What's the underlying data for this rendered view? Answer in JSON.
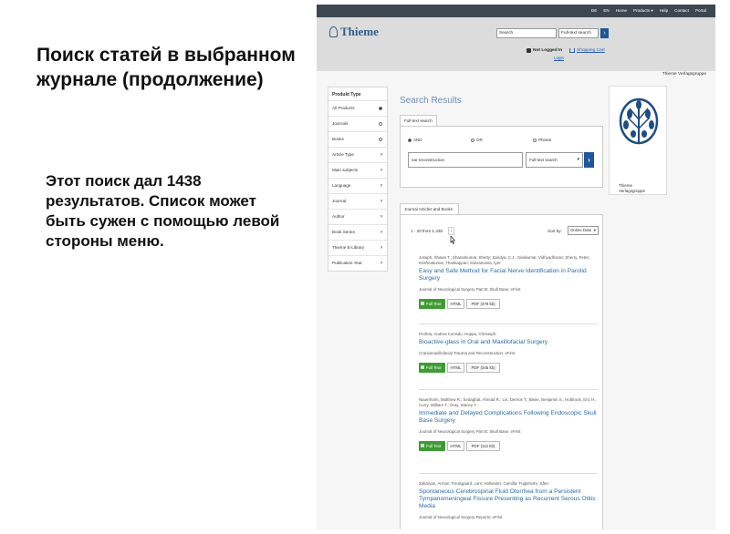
{
  "slide": {
    "title": "Поиск статей в выбранном журнале (продолжение)",
    "body": "Этот поиск дал 1438 результатов. Список может быть сужен с помощью левой стороны меню."
  },
  "topbar": {
    "links": [
      "DE",
      "EN",
      "Home",
      "Products ▾",
      "Help",
      "Contact",
      "Portal"
    ]
  },
  "header": {
    "logo": "Thieme",
    "search_value": "Search",
    "search_scope": "Full-text search",
    "login_status": "Not Logged In",
    "login_link": "Login",
    "cart_link": "Shopping Cart",
    "brand": "Thieme Verlagsgruppe"
  },
  "sidebar": {
    "heading": "Produkt Type",
    "items": [
      {
        "label": "All Products",
        "control": "radio-on"
      },
      {
        "label": "Journals",
        "control": "radio"
      },
      {
        "label": "Books",
        "control": "radio"
      },
      {
        "label": "Article Type",
        "control": "chevron"
      },
      {
        "label": "Main subjects",
        "control": "chevron"
      },
      {
        "label": "Language",
        "control": "chevron"
      },
      {
        "label": "Journal",
        "control": "chevron"
      },
      {
        "label": "Author",
        "control": "chevron"
      },
      {
        "label": "Book Series",
        "control": "chevron"
      },
      {
        "label": "Thieme E-Library",
        "control": "chevron"
      },
      {
        "label": "Publication Year",
        "control": "chevron"
      }
    ]
  },
  "search_panel": {
    "heading": "Search Results",
    "tab": "Full-text search",
    "options": [
      "AND",
      "OR",
      "Phrase"
    ],
    "query": "ear reconstruction",
    "scope": "Full-text search"
  },
  "side_panel": {
    "caption_line1": "Thieme",
    "caption_line2": "Verlagsgruppe"
  },
  "results": {
    "tab": "Journal Articles and Books",
    "count": "1 - 20 from 1,438",
    "sort_label": "Sort by:",
    "sort_value": "Online Date",
    "button_full": "Full Text",
    "button_html": "HTML",
    "items": [
      {
        "authors": "Joseph, Shawn T.; Sharankumar, Shetty; Sandya, C.J.; Sivakumar, Vidhyadharan; Sherry, Peter; Krishnakumar, Thankappan; Subramania, Iyer:",
        "title": "Easy and Safe Method for Facial Nerve Identification in Parotid Surgery",
        "source": "Journal of Neurological Surgery Part B: Skull Base; eFirst",
        "pdf": "PDF (379 kb)"
      },
      {
        "authors": "Profeta, Andrea Corrado; Huppa, Christoph:",
        "title": "Bioactive-glass in Oral and Maxillofacial Surgery",
        "source": "Craniomaxillofacial Trauma and Reconstruction; eFirst",
        "pdf": "PDF (345 kb)"
      },
      {
        "authors": "Nauerholm, Matthew R.; Sedaghat, Ahmad R.; Lin, Derrick T.; Bleier, Benjamin S.; Holbrook, Eric H.; Curry, William T.; Gray, Stacey T.:",
        "title": "Immediate and Delayed Complications Following Endoscopic Skull Base Surgery",
        "source": "Journal of Neurological Surgery Part B: Skull Base; eFirst",
        "pdf": "PDF (112 kb)"
      },
      {
        "authors": "Zakaryan, Arman; Poulsgaard, Lars; Hollander, Camilla; Fugleholm, Kåre:",
        "title": "Spontaneous Cerebrospinal Fluid Otorrhea from a Persistent Tympanomeningeal Fissure Presenting as Recurrent Serous Otitis Media",
        "source": "Journal of Neurological Surgery Reports; eFirst",
        "pdf": ""
      }
    ]
  },
  "colors": {
    "accent": "#1e5799",
    "link": "#2b6aa5",
    "fulltext_green": "#3f9c35",
    "topbar": "#3d4750"
  }
}
